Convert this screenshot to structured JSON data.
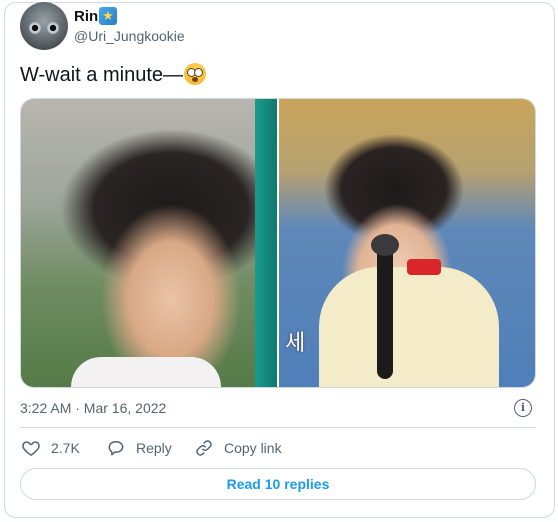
{
  "author": {
    "name": "Rin",
    "handle": "@Uri_Jungkookie",
    "badge_icon": "star-badge-icon"
  },
  "tweet": {
    "text": "W-wait a minute—",
    "emoji": "flushed-face-emoji"
  },
  "media": {
    "left_photo": "boy-portrait-photo",
    "right_photo": "boy-with-microphone-photo",
    "right_photo_caption": "세"
  },
  "timestamp": "3:22 AM · Mar 16, 2022",
  "actions": {
    "like_count": "2.7K",
    "reply_label": "Reply",
    "copy_link_label": "Copy link"
  },
  "read_replies_label": "Read 10 replies",
  "colors": {
    "accent": "#1d9bf0",
    "secondary_text": "#536471",
    "border": "#cfd9de"
  }
}
